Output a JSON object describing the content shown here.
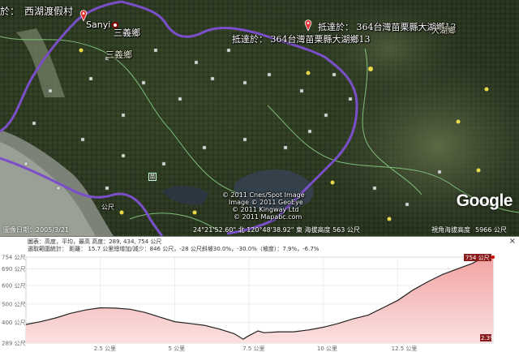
{
  "map": {
    "labels": {
      "west_lake_resort": "西湖渡假村",
      "arrive_prefix": "於：",
      "sanyi_en": "Sanyi",
      "sanyi_township": "三義鄉",
      "sanyi_township_2": "三義鄉",
      "arrive_1": "抵達於：  364台灣苗栗縣大湖鄉13",
      "arrive_2": "抵達於：  364台灣苗栗縣大湖鄉13",
      "dahu_township": "大湖鄉",
      "road_label": "苗",
      "altitude_label": "公尺"
    },
    "attribution": {
      "line1": "© 2011 Cnes/Spot Image",
      "line2": "Image © 2011 GeoEye",
      "line3": "© 2011 Kingway Ltd",
      "line4": "© 2011 Mapabc.com"
    },
    "google_logo": "Google",
    "status": {
      "imagery_date": "圖像日期：2005/3/21",
      "coords": "24°21'52.60\" 北  120°48'38.92\" 東  海拔高度  563 公尺",
      "eye_alt": "視角海拔高度",
      "eye_alt_value": "5966 公尺"
    },
    "icons": [
      "red-pin-icon",
      "poi-icon",
      "road-marker-icon"
    ]
  },
  "profile": {
    "info_line1": "圖表：高度，平均，最高  高度：289, 434, 754 公尺",
    "info_line2": "選取範圍統計：  距離：  15.7 公里總增加/減少：846 公尺，-28 公尺斜坡30.0%，-30.0%（坡度）：7.9%，-6.7%",
    "close_label": "×",
    "y_ticks": [
      "754 公尺",
      "690 公尺",
      "600 公尺",
      "500 公尺",
      "400 公尺",
      "289 公尺"
    ],
    "x_ticks": [
      "2.5 公里",
      "5 公里",
      "7.5 公里",
      "10 公里",
      "12.5 公里"
    ],
    "max_badge": "754 公尺",
    "grade_badge": "2.3%"
  },
  "chart_data": {
    "type": "area",
    "title": "",
    "xlabel": "",
    "ylabel": "",
    "x_unit": "公里",
    "y_unit": "公尺",
    "xlim": [
      0,
      15.7
    ],
    "ylim": [
      289,
      754
    ],
    "x": [
      0,
      0.5,
      1.0,
      1.5,
      2.0,
      2.5,
      3.0,
      3.5,
      4.0,
      4.5,
      5.0,
      5.5,
      6.0,
      6.5,
      7.0,
      7.3,
      7.5,
      7.8,
      8.0,
      8.5,
      9.0,
      9.5,
      10.0,
      10.5,
      11.0,
      11.5,
      12.0,
      12.5,
      13.0,
      13.5,
      14.0,
      14.5,
      15.0,
      15.3,
      15.7
    ],
    "series": [
      {
        "values": [
          390,
          405,
          425,
          450,
          468,
          480,
          478,
          472,
          455,
          430,
          405,
          395,
          385,
          365,
          340,
          310,
          330,
          355,
          345,
          350,
          350,
          360,
          375,
          395,
          420,
          440,
          480,
          520,
          575,
          620,
          660,
          690,
          720,
          745,
          754
        ]
      }
    ]
  }
}
